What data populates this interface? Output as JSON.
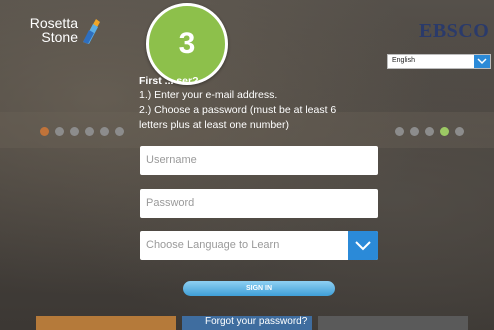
{
  "header": {
    "brand_line1": "Rosetta",
    "brand_line2": "Stone",
    "partner_logo": "EBSCO",
    "interface_language": "English"
  },
  "step_badge": "3",
  "instructions": {
    "title": "First ... ser?",
    "line1": "1.) Enter your e-mail address.",
    "line2": "2.) Choose a password (must be at least 6",
    "line3": "letters plus at least one number)"
  },
  "form": {
    "username_placeholder": "Username",
    "password_placeholder": "Password",
    "language_placeholder": "Choose Language to Learn",
    "signin_label": "SIGN IN",
    "forgot_label": "Forgot your password?"
  },
  "colors": {
    "accent": "#2b8ad8",
    "badge": "#8dc04b"
  },
  "icons": [
    "rosetta-stone-logo-icon",
    "chevron-down-icon"
  ]
}
